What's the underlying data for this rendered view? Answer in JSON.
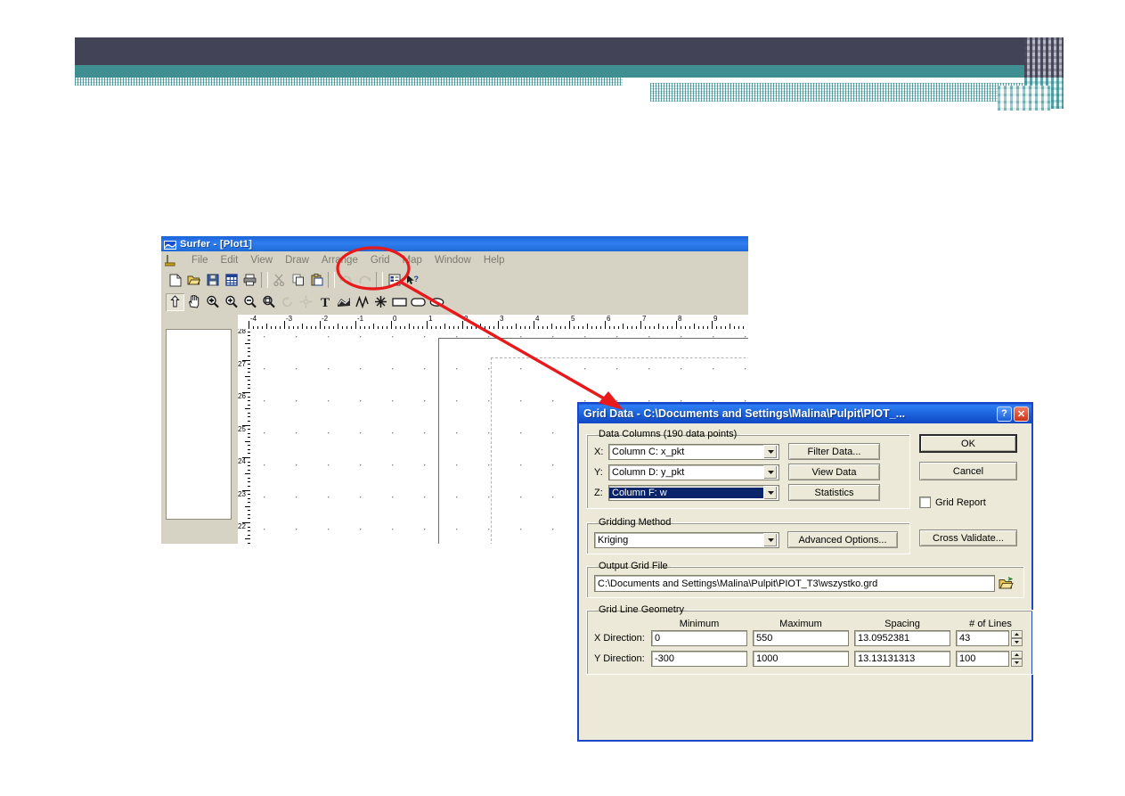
{
  "slide": {
    "header_bands": [
      "dark-slate-band",
      "teal-band",
      "hatched-band"
    ],
    "colors": {
      "dark": "#434358",
      "teal": "#3f8e92",
      "hatch": "#a8cfd1",
      "annotation_red": "#e8191b",
      "title_blue": "#1f6ad8",
      "dialog_face": "#ece9d8",
      "selection_blue": "#0a246a"
    }
  },
  "surfer": {
    "title": "Surfer - [Plot1]",
    "title_icon": "surfer-wave-icon",
    "menu": [
      {
        "label": "File"
      },
      {
        "label": "Edit"
      },
      {
        "label": "View"
      },
      {
        "label": "Draw"
      },
      {
        "label": "Arrange"
      },
      {
        "label": "Grid"
      },
      {
        "label": "Map"
      },
      {
        "label": "Window"
      },
      {
        "label": "Help"
      }
    ],
    "toolbar_main": [
      {
        "icon": "new-document-icon"
      },
      {
        "icon": "open-folder-icon"
      },
      {
        "icon": "save-disk-icon"
      },
      {
        "icon": "worksheet-grid-icon"
      },
      {
        "icon": "print-icon"
      },
      {
        "icon": "cut-scissors-icon"
      },
      {
        "icon": "copy-icon"
      },
      {
        "icon": "paste-clipboard-icon"
      },
      {
        "icon": "undo-arrow-icon"
      },
      {
        "icon": "redo-arrow-icon"
      },
      {
        "icon": "properties-icon"
      },
      {
        "icon": "help-pointer-icon"
      }
    ],
    "toolbar_draw": [
      {
        "icon": "select-arrow-icon"
      },
      {
        "icon": "pan-hand-icon"
      },
      {
        "icon": "zoom-selection-icon"
      },
      {
        "icon": "zoom-in-icon"
      },
      {
        "icon": "zoom-out-icon"
      },
      {
        "icon": "zoom-page-icon"
      },
      {
        "icon": "rotate-icon"
      },
      {
        "icon": "reshape-icon"
      },
      {
        "icon": "text-tool-icon"
      },
      {
        "icon": "polygon-tool-icon"
      },
      {
        "icon": "polyline-tool-icon"
      },
      {
        "icon": "symbol-tool-icon"
      },
      {
        "icon": "rectangle-tool-icon"
      },
      {
        "icon": "rounded-rectangle-tool-icon"
      },
      {
        "icon": "ellipse-tool-icon"
      }
    ],
    "ruler_h_labels": [
      "-4",
      "-3",
      "-2",
      "-1",
      "0",
      "1",
      "2",
      "3",
      "4",
      "5",
      "6",
      "7",
      "8",
      "9"
    ],
    "ruler_v_labels": [
      "28",
      "27",
      "26",
      "25",
      "24",
      "23",
      "22"
    ]
  },
  "dialog": {
    "title": "Grid Data - C:\\Documents and Settings\\Malina\\Pulpit\\PIOT_...",
    "help_button": "?",
    "close_button": "✕",
    "data_columns": {
      "legend": "Data Columns    (190 data points)",
      "rows": [
        {
          "label": "X:",
          "value": "Column C:  x_pkt",
          "button": "Filter Data...",
          "selected": false
        },
        {
          "label": "Y:",
          "value": "Column D:  y_pkt",
          "button": "View Data",
          "selected": false
        },
        {
          "label": "Z:",
          "value": "Column F:  w",
          "button": "Statistics",
          "selected": true
        }
      ]
    },
    "gridding_method": {
      "legend": "Gridding Method",
      "value": "Kriging",
      "advanced_button": "Advanced Options..."
    },
    "output_grid_file": {
      "legend": "Output Grid File",
      "value": "C:\\Documents and Settings\\Malina\\Pulpit\\PIOT_T3\\wszystko.grd",
      "browse_icon": "open-folder-icon"
    },
    "grid_line_geometry": {
      "legend": "Grid Line Geometry",
      "headers": [
        "Minimum",
        "Maximum",
        "Spacing",
        "# of Lines"
      ],
      "rows": [
        {
          "label": "X Direction:",
          "minimum": "0",
          "maximum": "550",
          "spacing": "13.0952381",
          "lines": "43"
        },
        {
          "label": "Y Direction:",
          "minimum": "-300",
          "maximum": "1000",
          "spacing": "13.13131313",
          "lines": "100"
        }
      ]
    },
    "actions": {
      "ok": "OK",
      "cancel": "Cancel",
      "cross_validate": "Cross Validate...",
      "grid_report_label": "Grid Report",
      "grid_report_checked": false
    }
  },
  "annotation": {
    "shape": "red-ellipse-with-arrow",
    "target_menu": "Grid"
  }
}
